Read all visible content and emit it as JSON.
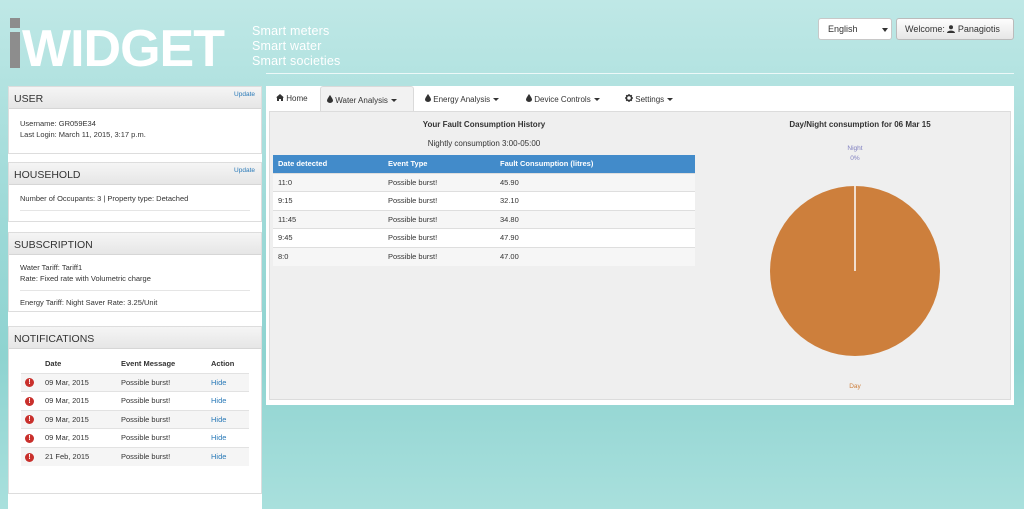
{
  "brand": {
    "logo_text": "iWIDGET",
    "taglines": [
      "Smart meters",
      "Smart water",
      "Smart societies"
    ]
  },
  "header": {
    "language": "English",
    "welcome_prefix": "Welcome:",
    "user_name": "Panagiotis"
  },
  "user_panel": {
    "title": "USER",
    "update_label": "Update",
    "username": "Username: GR059E34",
    "last_login": "Last Login: March 11, 2015, 3:17 p.m."
  },
  "household_panel": {
    "title": "HOUSEHOLD",
    "update_label": "Update",
    "info": "Number of Occupants: 3 | Property type: Detached"
  },
  "subscription_panel": {
    "title": "SUBSCRIPTION",
    "water_tariff": "Water Tariff: Tariff1",
    "rate": "Rate: Fixed rate with Volumetric charge",
    "energy_tariff": "Energy Tariff: Night Saver Rate: 3.25/Unit"
  },
  "notifications_panel": {
    "title": "NOTIFICATIONS",
    "columns": [
      "Date",
      "Event Message",
      "Action"
    ],
    "rows": [
      {
        "date": "09 Mar, 2015",
        "message": "Possible burst!",
        "action": "Hide"
      },
      {
        "date": "09 Mar, 2015",
        "message": "Possible burst!",
        "action": "Hide"
      },
      {
        "date": "09 Mar, 2015",
        "message": "Possible burst!",
        "action": "Hide"
      },
      {
        "date": "09 Mar, 2015",
        "message": "Possible burst!",
        "action": "Hide"
      },
      {
        "date": "21 Feb, 2015",
        "message": "Possible burst!",
        "action": "Hide"
      }
    ]
  },
  "tabs": [
    {
      "label": "Home",
      "icon": "home-icon",
      "active": false
    },
    {
      "label": "Water Analysis",
      "icon": "water-drop-icon",
      "active": true
    },
    {
      "label": "Energy Analysis",
      "icon": "water-drop-icon",
      "active": false
    },
    {
      "label": "Device Controls",
      "icon": "water-drop-icon",
      "active": false
    },
    {
      "label": "Settings",
      "icon": "gear-icon",
      "active": false
    }
  ],
  "fault_history": {
    "title": "Your Fault Consumption History",
    "subtitle": "Nightly consumption 3:00-05:00",
    "columns": [
      "Date detected",
      "Event Type",
      "Fault Consumption (litres)"
    ],
    "rows": [
      {
        "date": "11:0",
        "event": "Possible burst!",
        "consumption": "45.90"
      },
      {
        "date": "9:15",
        "event": "Possible burst!",
        "consumption": "32.10"
      },
      {
        "date": "11:45",
        "event": "Possible burst!",
        "consumption": "34.80"
      },
      {
        "date": "9:45",
        "event": "Possible burst!",
        "consumption": "47.90"
      },
      {
        "date": "8:0",
        "event": "Possible burst!",
        "consumption": "47.00"
      }
    ]
  },
  "chart_data": {
    "type": "pie",
    "title": "Day/Night consumption for 06 Mar 15",
    "slices": [
      {
        "label": "Night",
        "value_label": "0%",
        "value": 0,
        "color": "#8080c0"
      },
      {
        "label": "Day",
        "value_label": "100%",
        "value": 100,
        "color": "#cd7f3c"
      }
    ]
  },
  "colors": {
    "accent_blue": "#428bca",
    "alert_red": "#c9302c",
    "link_blue": "#2a7ab8"
  }
}
